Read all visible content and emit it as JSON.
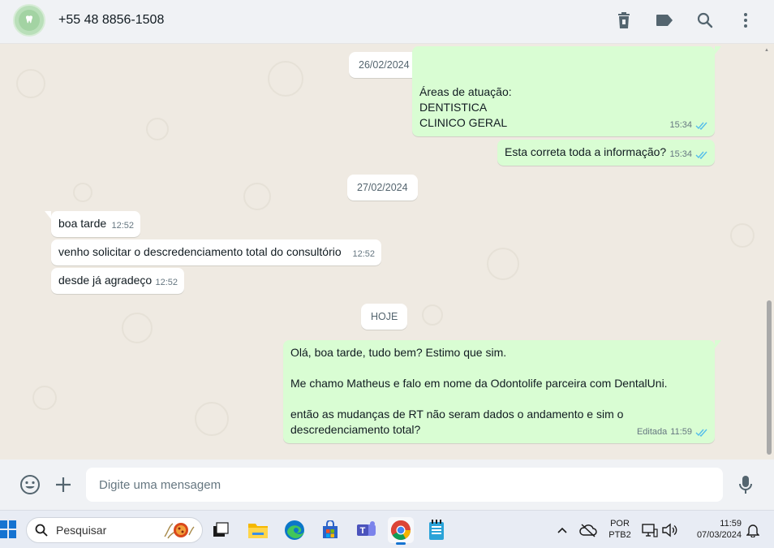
{
  "header": {
    "contact_name": "+55 48 8856-1508",
    "icons": [
      "delete-icon",
      "label-icon",
      "search-icon",
      "more-vertical-icon"
    ]
  },
  "chat": {
    "date_separators": [
      "26/02/2024",
      "27/02/2024",
      "HOJE"
    ],
    "messages": [
      {
        "direction": "outgoing",
        "text": "Áreas de atuação:\nDENTISTICA\nCLINICO GERAL",
        "time": "15:34",
        "status": "read"
      },
      {
        "direction": "outgoing",
        "text": "Esta correta toda a informação?",
        "time": "15:34",
        "status": "read"
      },
      {
        "direction": "incoming",
        "text": "boa tarde",
        "time": "12:52"
      },
      {
        "direction": "incoming",
        "text": "venho solicitar o descredenciamento total do consultório",
        "time": "12:52"
      },
      {
        "direction": "incoming",
        "text": "desde já agradeço",
        "time": "12:52"
      },
      {
        "direction": "outgoing",
        "text": "Olá, boa tarde, tudo bem? Estimo que sim.\n\nMe chamo Matheus e falo em nome da Odontolife parceira com DentalUni.\n\nentão as mudanças de RT não seram dados o andamento e sim o descredenciamento total?",
        "time": "11:59",
        "edited_label": "Editada",
        "status": "read"
      }
    ]
  },
  "composer": {
    "placeholder": "Digite uma mensagem",
    "icons": [
      "emoji-icon",
      "plus-icon",
      "microphone-icon"
    ]
  },
  "taskbar": {
    "search_placeholder": "Pesquisar",
    "apps": [
      "task-view-icon",
      "file-explorer-icon",
      "edge-icon",
      "store-icon",
      "teams-icon",
      "chrome-icon",
      "notepad-icon"
    ],
    "language_line1": "POR",
    "language_line2": "PTB2",
    "time": "11:59",
    "date": "07/03/2024"
  },
  "colors": {
    "outgoing_bubble": "#d9fdd3",
    "incoming_bubble": "#ffffff",
    "chat_background": "#efeae2",
    "read_ticks": "#53bdeb",
    "header_background": "#f0f2f5"
  }
}
